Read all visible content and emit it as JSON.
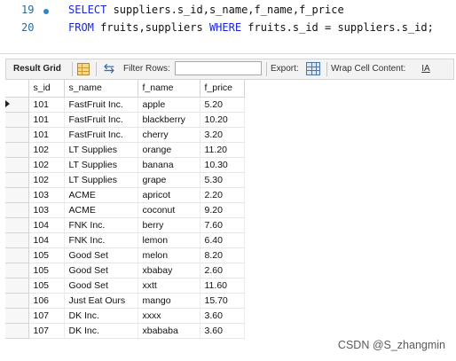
{
  "editor": {
    "lines": [
      {
        "number": "19",
        "tokens": [
          {
            "text": "SELECT",
            "kw": true
          },
          {
            "text": " suppliers.s_id,s_name,f_name,f_price",
            "kw": false
          }
        ]
      },
      {
        "number": "20",
        "tokens": [
          {
            "text": "FROM",
            "kw": true
          },
          {
            "text": " fruits,suppliers ",
            "kw": false
          },
          {
            "text": "WHERE",
            "kw": true
          },
          {
            "text": " fruits.s_id = suppliers.s_id;",
            "kw": false
          }
        ]
      }
    ]
  },
  "toolbar": {
    "result_grid_label": "Result Grid",
    "filter_label": "Filter Rows:",
    "filter_value": "",
    "export_label": "Export:",
    "wrap_label": "Wrap Cell Content:",
    "wrap_icon_glyph": "IA"
  },
  "grid": {
    "columns": [
      "s_id",
      "s_name",
      "f_name",
      "f_price"
    ],
    "rows": [
      [
        "101",
        "FastFruit Inc.",
        "apple",
        "5.20"
      ],
      [
        "101",
        "FastFruit Inc.",
        "blackberry",
        "10.20"
      ],
      [
        "101",
        "FastFruit Inc.",
        "cherry",
        "3.20"
      ],
      [
        "102",
        "LT Supplies",
        "orange",
        "11.20"
      ],
      [
        "102",
        "LT Supplies",
        "banana",
        "10.30"
      ],
      [
        "102",
        "LT Supplies",
        "grape",
        "5.30"
      ],
      [
        "103",
        "ACME",
        "apricot",
        "2.20"
      ],
      [
        "103",
        "ACME",
        "coconut",
        "9.20"
      ],
      [
        "104",
        "FNK Inc.",
        "berry",
        "7.60"
      ],
      [
        "104",
        "FNK Inc.",
        "lemon",
        "6.40"
      ],
      [
        "105",
        "Good Set",
        "melon",
        "8.20"
      ],
      [
        "105",
        "Good Set",
        "xbabay",
        "2.60"
      ],
      [
        "105",
        "Good Set",
        "xxtt",
        "11.60"
      ],
      [
        "106",
        "Just Eat Ours",
        "mango",
        "15.70"
      ],
      [
        "107",
        "DK Inc.",
        "xxxx",
        "3.60"
      ],
      [
        "107",
        "DK Inc.",
        "xbababa",
        "3.60"
      ]
    ],
    "current_row": 0
  },
  "watermark": "CSDN @S_zhangmin",
  "icons": {
    "grid": "grid-icon",
    "refresh": "refresh-icon",
    "export": "export-icon",
    "wrap": "wrap-cell-icon",
    "row_pointer": "row-pointer-icon"
  },
  "colors": {
    "keyword": "#1a26d6",
    "line_number": "#2b6a9a",
    "fold_marker": "#2f86c8",
    "toolbar_bg": "#f3f3f3"
  }
}
